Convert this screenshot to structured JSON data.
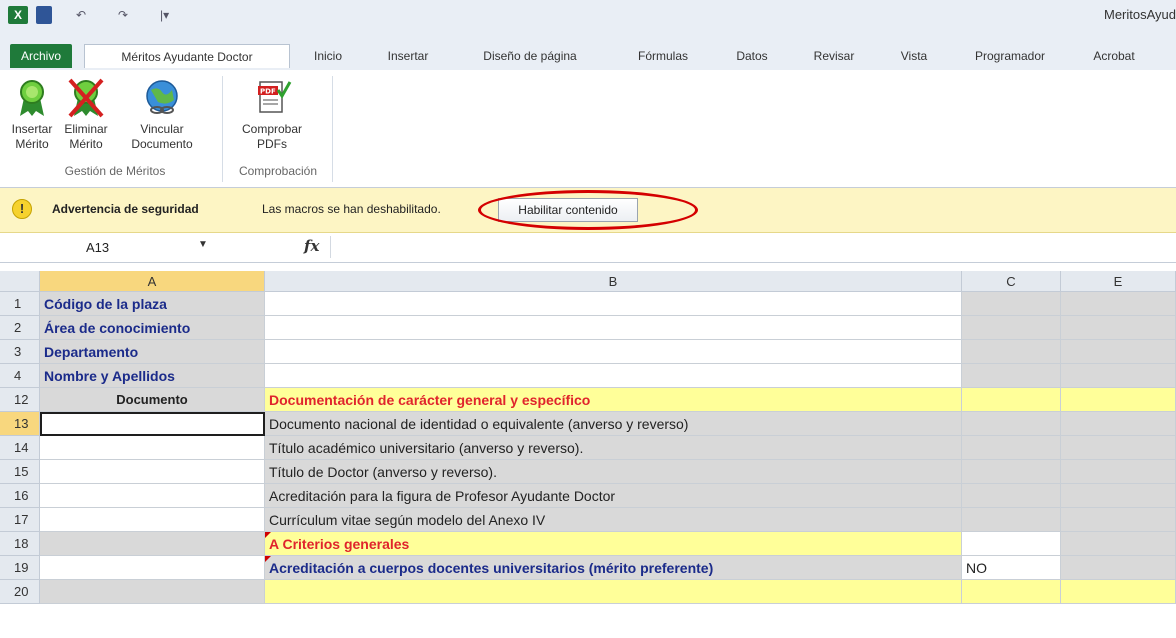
{
  "window": {
    "title": "MeritosAyud"
  },
  "quick_access": {
    "logo": "X",
    "undo": "↶",
    "redo": "↷",
    "customize": "|▾"
  },
  "tabs": [
    {
      "label": "Archivo"
    },
    {
      "label": "Méritos Ayudante Doctor"
    },
    {
      "label": "Inicio"
    },
    {
      "label": "Insertar"
    },
    {
      "label": "Diseño de página"
    },
    {
      "label": "Fórmulas"
    },
    {
      "label": "Datos"
    },
    {
      "label": "Revisar"
    },
    {
      "label": "Vista"
    },
    {
      "label": "Programador"
    },
    {
      "label": "Acrobat"
    }
  ],
  "ribbon": {
    "buttons": [
      {
        "line1": "Insertar",
        "line2": "Mérito",
        "icon": "green-ribbon-award-icon"
      },
      {
        "line1": "Eliminar",
        "line2": "Mérito",
        "icon": "crossed-award-icon"
      },
      {
        "line1": "Vincular",
        "line2": "Documento",
        "icon": "globe-link-icon"
      },
      {
        "line1": "Comprobar",
        "line2": "PDFs",
        "icon": "pdf-check-icon"
      }
    ],
    "groups": [
      {
        "label": "Gestión de Méritos"
      },
      {
        "label": "Comprobación"
      }
    ]
  },
  "security_bar": {
    "icon": "!",
    "title": "Advertencia de seguridad",
    "message": "Las macros se han deshabilitado.",
    "button": "Habilitar contenido"
  },
  "formula_bar": {
    "name_box": "A13",
    "fx": "fx",
    "formula": ""
  },
  "columns": [
    {
      "label": ""
    },
    {
      "label": "A"
    },
    {
      "label": "B"
    },
    {
      "label": "C"
    },
    {
      "label": "E"
    }
  ],
  "rows": [
    {
      "num": "1",
      "a": "Código de la plaza",
      "b": "",
      "c": ""
    },
    {
      "num": "2",
      "a": "Área de conocimiento",
      "b": "",
      "c": ""
    },
    {
      "num": "3",
      "a": "Departamento",
      "b": "",
      "c": ""
    },
    {
      "num": "4",
      "a": "Nombre y Apellidos",
      "b": "",
      "c": ""
    },
    {
      "num": "12",
      "a": "Documento",
      "b": "Documentación de carácter general y específico",
      "c": ""
    },
    {
      "num": "13",
      "a": "",
      "b": "Documento nacional de identidad  o equivalente (anverso y reverso)",
      "c": ""
    },
    {
      "num": "14",
      "a": "",
      "b": "Título académico universitario (anverso y reverso).",
      "c": ""
    },
    {
      "num": "15",
      "a": "",
      "b": "Título de Doctor (anverso y reverso).",
      "c": ""
    },
    {
      "num": "16",
      "a": "",
      "b": "Acreditación  para la figura de Profesor Ayudante Doctor",
      "c": ""
    },
    {
      "num": "17",
      "a": "",
      "b": "Currículum vitae según modelo del Anexo IV",
      "c": ""
    },
    {
      "num": "18",
      "a": "",
      "b": "A Criterios generales",
      "c": ""
    },
    {
      "num": "19",
      "a": "",
      "b": "Acreditación a cuerpos docentes universitarios (mérito preferente)",
      "c": "NO"
    },
    {
      "num": "20",
      "a": "",
      "b": "",
      "c": ""
    }
  ],
  "colors": {
    "header_yellow": "#ffff99",
    "selection": "#f8d77e",
    "navy_text": "#1b2b8a",
    "red_text": "#e0242c",
    "highlight_ring": "#d40000"
  }
}
